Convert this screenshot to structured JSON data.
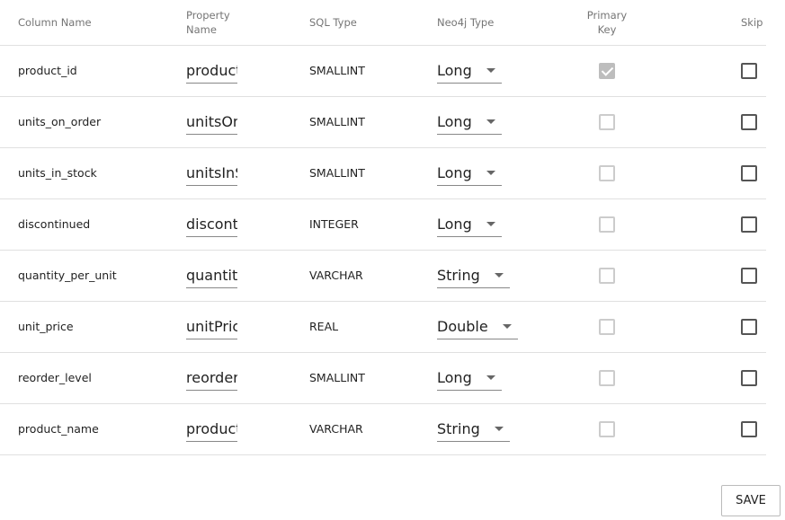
{
  "headers": {
    "column": "Column Name",
    "property": "Property\nName",
    "sql": "SQL Type",
    "neo4j": "Neo4j Type",
    "pk": "Primary\nKey",
    "skip": "Skip"
  },
  "rows": [
    {
      "column": "product_id",
      "property": "productId",
      "sql": "SMALLINT",
      "neo4j": "Long",
      "pk": true,
      "skip": false
    },
    {
      "column": "units_on_order",
      "property": "unitsOnOrder",
      "sql": "SMALLINT",
      "neo4j": "Long",
      "pk": false,
      "skip": false
    },
    {
      "column": "units_in_stock",
      "property": "unitsInStock",
      "sql": "SMALLINT",
      "neo4j": "Long",
      "pk": false,
      "skip": false
    },
    {
      "column": "discontinued",
      "property": "discontinued",
      "sql": "INTEGER",
      "neo4j": "Long",
      "pk": false,
      "skip": false
    },
    {
      "column": "quantity_per_unit",
      "property": "quantityPerUnit",
      "sql": "VARCHAR",
      "neo4j": "String",
      "pk": false,
      "skip": false
    },
    {
      "column": "unit_price",
      "property": "unitPrice",
      "sql": "REAL",
      "neo4j": "Double",
      "pk": false,
      "skip": false
    },
    {
      "column": "reorder_level",
      "property": "reorderLevel",
      "sql": "SMALLINT",
      "neo4j": "Long",
      "pk": false,
      "skip": false
    },
    {
      "column": "product_name",
      "property": "productName",
      "sql": "VARCHAR",
      "neo4j": "String",
      "pk": false,
      "skip": false
    }
  ],
  "save_label": "SAVE"
}
